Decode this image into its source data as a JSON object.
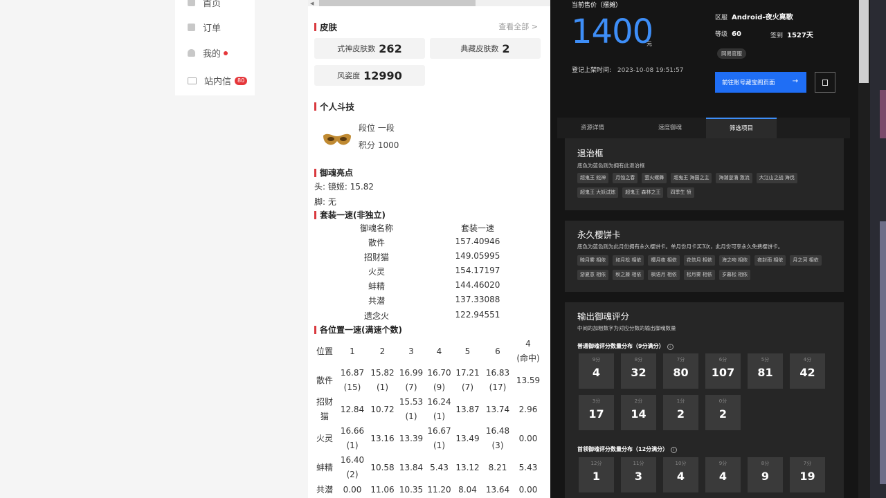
{
  "nav": {
    "items": [
      {
        "label": "首页",
        "icon": "home-icon"
      },
      {
        "label": "订单",
        "icon": "order-icon"
      },
      {
        "label": "我的",
        "icon": "user-icon"
      },
      {
        "label": "站内信",
        "icon": "mail-icon",
        "badge": "80"
      }
    ]
  },
  "skins": {
    "title": "皮肤",
    "view_all": "查看全部 >",
    "shishen_label": "式神皮肤数",
    "shishen_value": "262",
    "dianzang_label": "典藏皮肤数",
    "dianzang_value": "2",
    "fengzi_label": "风姿度",
    "fengzi_value": "12990"
  },
  "pvp": {
    "title": "个人斗技",
    "rank_label": "段位",
    "rank_value": "一段",
    "score_label": "积分",
    "score_value": "1000"
  },
  "yuhun_highlight": {
    "title": "御魂亮点",
    "head": "头: 镜姬: 15.82",
    "foot": "脚: 无"
  },
  "set_speed": {
    "title": "套装一速(非独立)",
    "col1": "御魂名称",
    "col2": "套装一速",
    "rows": [
      {
        "name": "散件",
        "value": "157.40946"
      },
      {
        "name": "招财猫",
        "value": "149.05995"
      },
      {
        "name": "火灵",
        "value": "154.17197"
      },
      {
        "name": "蚌精",
        "value": "144.46020"
      },
      {
        "name": "共潜",
        "value": "137.33088"
      },
      {
        "name": "遗念火",
        "value": "122.94551"
      }
    ]
  },
  "pos_speed": {
    "title": "各位置一速(满速个数)",
    "headers": [
      "位置",
      "1",
      "2",
      "3",
      "4",
      "5",
      "6",
      "4\n(命中)"
    ],
    "rows": [
      [
        "散件",
        "16.87\n(15)",
        "15.82\n(1)",
        "16.99\n(7)",
        "16.70\n(9)",
        "17.21\n(7)",
        "16.83\n(17)",
        "13.59"
      ],
      [
        "招财\n猫",
        "12.84",
        "10.72",
        "15.53\n(1)",
        "16.24\n(1)",
        "13.87",
        "13.74",
        "2.96"
      ],
      [
        "火灵",
        "16.66\n(1)",
        "13.16",
        "13.39",
        "16.67\n(1)",
        "13.49",
        "16.48\n(3)",
        "0.00"
      ],
      [
        "蚌精",
        "16.40\n(2)",
        "10.58",
        "13.84",
        "5.43",
        "13.12",
        "8.21",
        "5.43"
      ],
      [
        "共潜",
        "0.00",
        "11.06",
        "10.35",
        "11.20",
        "8.04",
        "13.64",
        "0.00"
      ]
    ]
  },
  "price": {
    "label": "当前售价（摆摊）",
    "value": "1400",
    "unit": "元",
    "listed_label": "登记上架时间:",
    "listed_time": "2023-10-08 19:51:57"
  },
  "account": {
    "server_label": "区服",
    "server_value": "Android-夜火离歌",
    "level_label": "等级",
    "level_value": "60",
    "signin_label": "签到",
    "signin_value": "1527天",
    "tag": "网易官服",
    "goto_button": "前往账号藏宝阁页面"
  },
  "tabs": [
    "资源详情",
    "速度御魂",
    "筛选项目"
  ],
  "tuizhi": {
    "title": "退治框",
    "sub": "底色为蓝色则为拥有此退治框",
    "chips": [
      "超鬼王 蛇神",
      "月蚀之春",
      "萤火螺舞",
      "超鬼王 海国之主",
      "海潮逆涌 激流",
      "大江山之战 海伐",
      "超鬼王 大妖试炼",
      "超鬼王 森林之王",
      "四季生 愤"
    ]
  },
  "sakura": {
    "title": "永久樱饼卡",
    "sub": "底色为蓝色则为此月份拥有永久樱饼卡。单月份月卡买3次，此月份可享永久免费樱饼卡。",
    "chips": [
      "睦月雾 相依",
      "如月松 相依",
      "樱月夜 相依",
      "花信月 相依",
      "海之吻 相依",
      "夜封雨 相依",
      "月之河 相依",
      "游夏意 相依",
      "秋之藤 相依",
      "枫语月 相依",
      "松月雾 相依",
      "岁暮松 相依"
    ]
  },
  "output": {
    "title": "输出御魂评分",
    "sub": "中间的加粗数字为对应分数的输出御魂数量",
    "normal_title": "普通御魂评分数量分布（9分满分）",
    "normal": [
      {
        "s": "9分",
        "n": "4"
      },
      {
        "s": "8分",
        "n": "32"
      },
      {
        "s": "7分",
        "n": "80"
      },
      {
        "s": "6分",
        "n": "107"
      },
      {
        "s": "5分",
        "n": "81"
      },
      {
        "s": "4分",
        "n": "42"
      },
      {
        "s": "3分",
        "n": "17"
      },
      {
        "s": "2分",
        "n": "14"
      },
      {
        "s": "1分",
        "n": "2"
      },
      {
        "s": "0分",
        "n": "2"
      }
    ],
    "head_title": "首领御魂评分数量分布（12分满分）",
    "head": [
      {
        "s": "12分",
        "n": "1"
      },
      {
        "s": "11分",
        "n": "3"
      },
      {
        "s": "10分",
        "n": "4"
      },
      {
        "s": "9分",
        "n": "4"
      },
      {
        "s": "8分",
        "n": "9"
      },
      {
        "s": "7分",
        "n": "19"
      }
    ]
  },
  "colors": {
    "accent": "#3e8ef7",
    "red": "#d9393e",
    "dark_bg": "#151515",
    "button": "#1f6ef5"
  }
}
